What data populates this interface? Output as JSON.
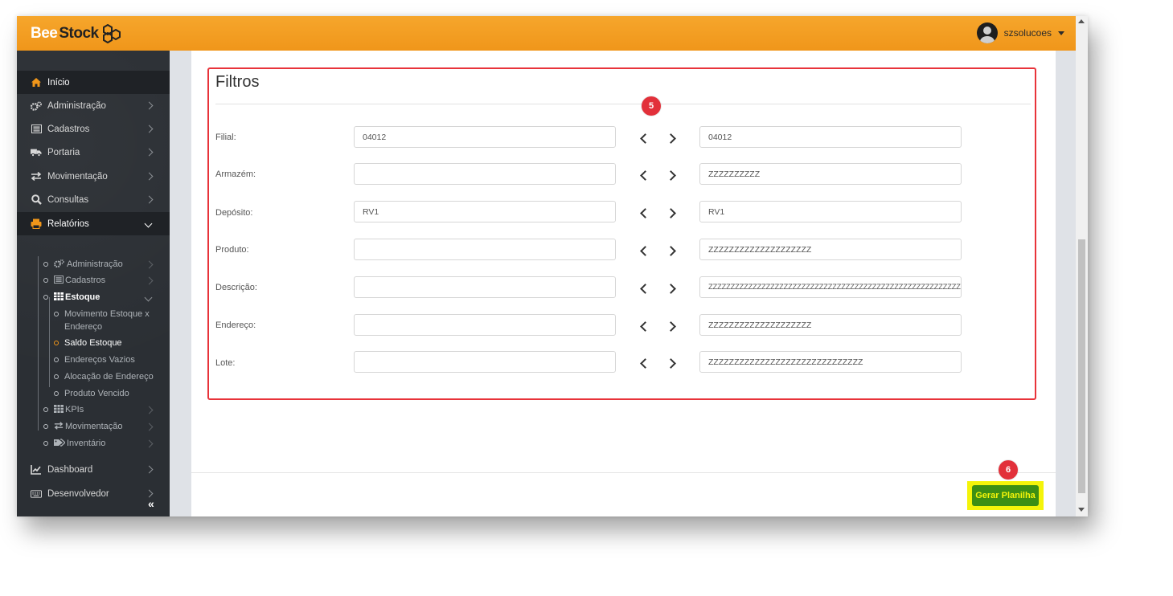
{
  "brand": {
    "part1": "Bee",
    "part2": "Stock"
  },
  "user": {
    "name": "szsolucoes"
  },
  "sidebar": {
    "items": [
      {
        "label": "Início"
      },
      {
        "label": "Administração"
      },
      {
        "label": "Cadastros"
      },
      {
        "label": "Portaria"
      },
      {
        "label": "Movimentação"
      },
      {
        "label": "Consultas"
      },
      {
        "label": "Relatórios"
      },
      {
        "label": "Dashboard"
      },
      {
        "label": "Desenvolvedor"
      }
    ],
    "relatorios_sub": [
      {
        "label": "Administração"
      },
      {
        "label": "Cadastros"
      },
      {
        "label": "Estoque"
      },
      {
        "label": "KPIs"
      },
      {
        "label": "Movimentação"
      },
      {
        "label": "Inventário"
      }
    ],
    "estoque_sub": [
      {
        "label": "Movimento Estoque x"
      },
      {
        "label": "Endereço"
      },
      {
        "label": "Saldo Estoque"
      },
      {
        "label": "Endereços Vazios"
      },
      {
        "label": "Alocação de Endereço"
      },
      {
        "label": "Produto Vencido"
      }
    ],
    "collapse": "«"
  },
  "filters": {
    "title": "Filtros",
    "badge": "5",
    "rows": [
      {
        "label": "Filial:",
        "from": "04012",
        "to": "04012"
      },
      {
        "label": "Armazém:",
        "from": "",
        "to": "ZZZZZZZZZZ"
      },
      {
        "label": "Depósito:",
        "from": "RV1",
        "to": "RV1"
      },
      {
        "label": "Produto:",
        "from": "",
        "to": "ZZZZZZZZZZZZZZZZZZZZ"
      },
      {
        "label": "Descrição:",
        "from": "",
        "to": "ZZZZZZZZZZZZZZZZZZZZZZZZZZZZZZZZZZZZZZZZZZZZZZZZZZZZZZZZZZ"
      },
      {
        "label": "Endereço:",
        "from": "",
        "to": "ZZZZZZZZZZZZZZZZZZZZ"
      },
      {
        "label": "Lote:",
        "from": "",
        "to": "ZZZZZZZZZZZZZZZZZZZZZZZZZZZZZZ"
      }
    ]
  },
  "footer": {
    "badge": "6",
    "generate_label": "Gerar Planilha"
  },
  "colors": {
    "accent": "#f0961a",
    "highlight": "#e8333a",
    "button": "#3c8f14",
    "button_text": "#f4f40a"
  }
}
